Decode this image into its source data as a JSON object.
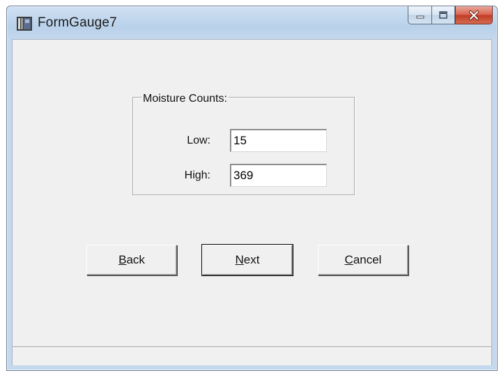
{
  "window": {
    "title": "FormGauge7"
  },
  "caption_buttons": {
    "minimize_icon": "minimize-icon",
    "maximize_icon": "maximize-icon",
    "close_icon": "close-icon",
    "close_color": "#c8432a"
  },
  "group": {
    "legend": "Moisture Counts:",
    "low_label": "Low:",
    "low_value": "15",
    "high_label": "High:",
    "high_value": "369"
  },
  "buttons": {
    "back": {
      "accel": "B",
      "rest": "ack"
    },
    "next": {
      "accel": "N",
      "rest": "ext"
    },
    "cancel": {
      "accel": "C",
      "rest": "ancel"
    }
  }
}
